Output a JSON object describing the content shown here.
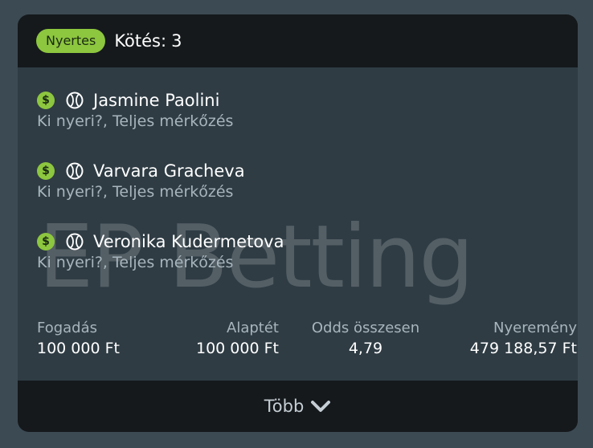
{
  "header": {
    "status": "Nyertes",
    "bets_label": "Kötés:",
    "bets_count": "3"
  },
  "watermark": "EP Betting",
  "selections": [
    {
      "player": "Jasmine Paolini",
      "market": "Ki nyeri?, Teljes mérkőzés",
      "icons": [
        "dollar-icon",
        "tennis-ball-icon"
      ]
    },
    {
      "player": "Varvara Gracheva",
      "market": "Ki nyeri?, Teljes mérkőzés",
      "icons": [
        "dollar-icon",
        "tennis-ball-icon"
      ]
    },
    {
      "player": "Veronika Kudermetova",
      "market": "Ki nyeri?, Teljes mérkőzés",
      "icons": [
        "dollar-icon",
        "tennis-ball-icon"
      ]
    }
  ],
  "totals": {
    "stake_label": "Fogadás",
    "stake_value": "100 000 Ft",
    "base_label": "Alaptét",
    "base_value": "100 000 Ft",
    "odds_label": "Odds összesen",
    "odds_value": "4,79",
    "win_label": "Nyeremény",
    "win_value": "479 188,57 Ft"
  },
  "footer": {
    "more_label": "Több"
  },
  "colors": {
    "accent": "#8dc63f",
    "card_bg": "#2f3c44",
    "header_bg": "#15191c",
    "page_bg": "#3c4a53"
  }
}
